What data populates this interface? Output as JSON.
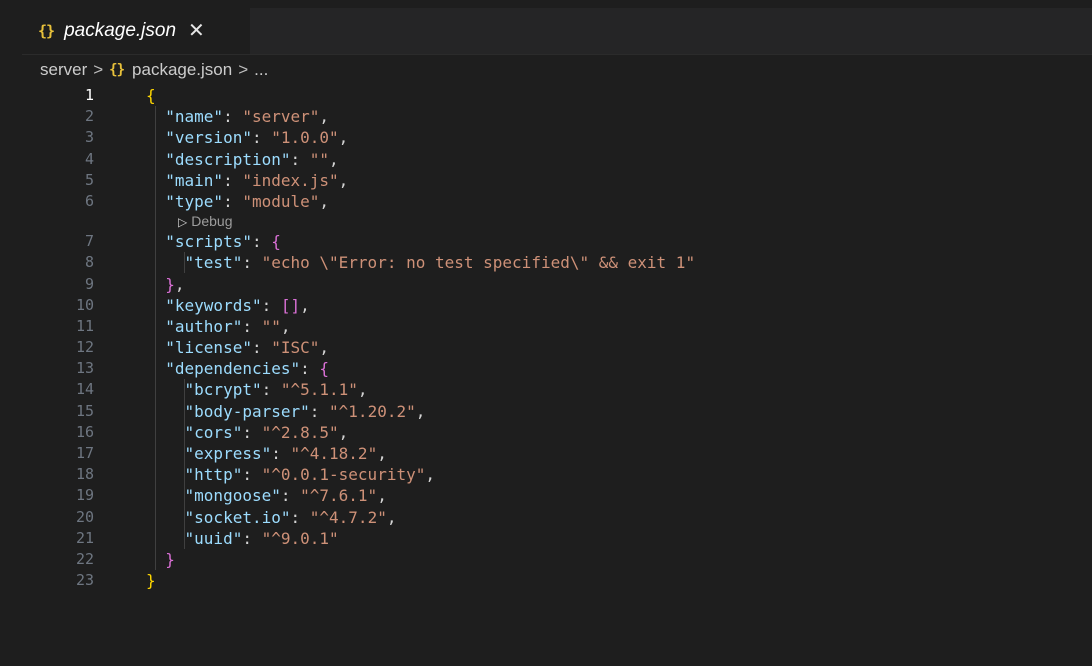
{
  "tab": {
    "label": "package.json",
    "icon": "json-braces-icon",
    "close": "✕"
  },
  "breadcrumb": {
    "folder": "server",
    "file": "package.json",
    "trail": "..."
  },
  "codelens": {
    "label": "Debug",
    "icon": "play-triangle-icon"
  },
  "lines": [
    {
      "num": "1",
      "tokens": [
        {
          "t": "{",
          "c": "b1"
        }
      ]
    },
    {
      "num": "2",
      "tokens": [
        {
          "t": "  "
        },
        {
          "t": "\"name\"",
          "c": "k"
        },
        {
          "t": ": ",
          "c": "p"
        },
        {
          "t": "\"server\"",
          "c": "s"
        },
        {
          "t": ",",
          "c": "p"
        }
      ]
    },
    {
      "num": "3",
      "tokens": [
        {
          "t": "  "
        },
        {
          "t": "\"version\"",
          "c": "k"
        },
        {
          "t": ": ",
          "c": "p"
        },
        {
          "t": "\"1.0.0\"",
          "c": "s"
        },
        {
          "t": ",",
          "c": "p"
        }
      ]
    },
    {
      "num": "4",
      "tokens": [
        {
          "t": "  "
        },
        {
          "t": "\"description\"",
          "c": "k"
        },
        {
          "t": ": ",
          "c": "p"
        },
        {
          "t": "\"\"",
          "c": "s"
        },
        {
          "t": ",",
          "c": "p"
        }
      ]
    },
    {
      "num": "5",
      "tokens": [
        {
          "t": "  "
        },
        {
          "t": "\"main\"",
          "c": "k"
        },
        {
          "t": ": ",
          "c": "p"
        },
        {
          "t": "\"index.js\"",
          "c": "s"
        },
        {
          "t": ",",
          "c": "p"
        }
      ]
    },
    {
      "num": "6",
      "tokens": [
        {
          "t": "  "
        },
        {
          "t": "\"type\"",
          "c": "k"
        },
        {
          "t": ": ",
          "c": "p"
        },
        {
          "t": "\"module\"",
          "c": "s"
        },
        {
          "t": ",",
          "c": "p"
        }
      ]
    },
    {
      "num": "7",
      "codelens": true,
      "tokens": [
        {
          "t": "  "
        },
        {
          "t": "\"scripts\"",
          "c": "k"
        },
        {
          "t": ": ",
          "c": "p"
        },
        {
          "t": "{",
          "c": "b2"
        }
      ]
    },
    {
      "num": "8",
      "tokens": [
        {
          "t": "    "
        },
        {
          "t": "\"test\"",
          "c": "k"
        },
        {
          "t": ": ",
          "c": "p"
        },
        {
          "t": "\"echo \\\"Error: no test specified\\\" && exit 1\"",
          "c": "s"
        }
      ]
    },
    {
      "num": "9",
      "tokens": [
        {
          "t": "  "
        },
        {
          "t": "}",
          "c": "b2"
        },
        {
          "t": ",",
          "c": "p"
        }
      ]
    },
    {
      "num": "10",
      "tokens": [
        {
          "t": "  "
        },
        {
          "t": "\"keywords\"",
          "c": "k"
        },
        {
          "t": ": ",
          "c": "p"
        },
        {
          "t": "[]",
          "c": "b2"
        },
        {
          "t": ",",
          "c": "p"
        }
      ]
    },
    {
      "num": "11",
      "tokens": [
        {
          "t": "  "
        },
        {
          "t": "\"author\"",
          "c": "k"
        },
        {
          "t": ": ",
          "c": "p"
        },
        {
          "t": "\"\"",
          "c": "s"
        },
        {
          "t": ",",
          "c": "p"
        }
      ]
    },
    {
      "num": "12",
      "tokens": [
        {
          "t": "  "
        },
        {
          "t": "\"license\"",
          "c": "k"
        },
        {
          "t": ": ",
          "c": "p"
        },
        {
          "t": "\"ISC\"",
          "c": "s"
        },
        {
          "t": ",",
          "c": "p"
        }
      ]
    },
    {
      "num": "13",
      "tokens": [
        {
          "t": "  "
        },
        {
          "t": "\"dependencies\"",
          "c": "k"
        },
        {
          "t": ": ",
          "c": "p"
        },
        {
          "t": "{",
          "c": "b2"
        }
      ]
    },
    {
      "num": "14",
      "tokens": [
        {
          "t": "    "
        },
        {
          "t": "\"bcrypt\"",
          "c": "k"
        },
        {
          "t": ": ",
          "c": "p"
        },
        {
          "t": "\"^5.1.1\"",
          "c": "s"
        },
        {
          "t": ",",
          "c": "p"
        }
      ]
    },
    {
      "num": "15",
      "tokens": [
        {
          "t": "    "
        },
        {
          "t": "\"body-parser\"",
          "c": "k"
        },
        {
          "t": ": ",
          "c": "p"
        },
        {
          "t": "\"^1.20.2\"",
          "c": "s"
        },
        {
          "t": ",",
          "c": "p"
        }
      ]
    },
    {
      "num": "16",
      "tokens": [
        {
          "t": "    "
        },
        {
          "t": "\"cors\"",
          "c": "k"
        },
        {
          "t": ": ",
          "c": "p"
        },
        {
          "t": "\"^2.8.5\"",
          "c": "s"
        },
        {
          "t": ",",
          "c": "p"
        }
      ]
    },
    {
      "num": "17",
      "tokens": [
        {
          "t": "    "
        },
        {
          "t": "\"express\"",
          "c": "k"
        },
        {
          "t": ": ",
          "c": "p"
        },
        {
          "t": "\"^4.18.2\"",
          "c": "s"
        },
        {
          "t": ",",
          "c": "p"
        }
      ]
    },
    {
      "num": "18",
      "tokens": [
        {
          "t": "    "
        },
        {
          "t": "\"http\"",
          "c": "k"
        },
        {
          "t": ": ",
          "c": "p"
        },
        {
          "t": "\"^0.0.1-security\"",
          "c": "s"
        },
        {
          "t": ",",
          "c": "p"
        }
      ]
    },
    {
      "num": "19",
      "tokens": [
        {
          "t": "    "
        },
        {
          "t": "\"mongoose\"",
          "c": "k"
        },
        {
          "t": ": ",
          "c": "p"
        },
        {
          "t": "\"^7.6.1\"",
          "c": "s"
        },
        {
          "t": ",",
          "c": "p"
        }
      ]
    },
    {
      "num": "20",
      "tokens": [
        {
          "t": "    "
        },
        {
          "t": "\"socket.io\"",
          "c": "k"
        },
        {
          "t": ": ",
          "c": "p"
        },
        {
          "t": "\"^4.7.2\"",
          "c": "s"
        },
        {
          "t": ",",
          "c": "p"
        }
      ]
    },
    {
      "num": "21",
      "tokens": [
        {
          "t": "    "
        },
        {
          "t": "\"uuid\"",
          "c": "k"
        },
        {
          "t": ": ",
          "c": "p"
        },
        {
          "t": "\"^9.0.1\"",
          "c": "s"
        }
      ]
    },
    {
      "num": "22",
      "tokens": [
        {
          "t": "  "
        },
        {
          "t": "}",
          "c": "b2"
        }
      ]
    },
    {
      "num": "23",
      "tokens": [
        {
          "t": "}",
          "c": "b1"
        }
      ]
    }
  ],
  "colors": {
    "key": "#9cdcfe",
    "string": "#ce9178",
    "bracket1": "#ffd700",
    "bracket2": "#da70d6"
  }
}
